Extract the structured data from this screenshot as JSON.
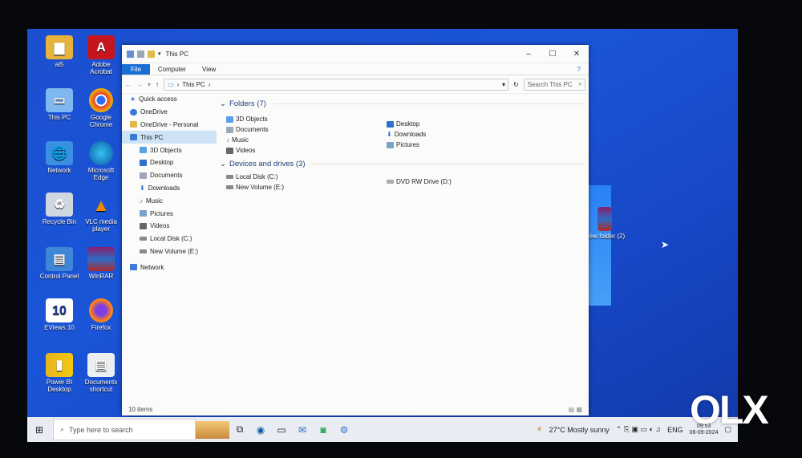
{
  "desktop": {
    "icons": [
      {
        "label": "ai5",
        "icon": "folder-icon"
      },
      {
        "label": "Adobe Acrobat",
        "icon": "acrobat-icon"
      },
      {
        "label": "This PC",
        "icon": "this-pc-icon"
      },
      {
        "label": "Google Chrome",
        "icon": "chrome-icon"
      },
      {
        "label": "Network",
        "icon": "network-icon"
      },
      {
        "label": "Microsoft Edge",
        "icon": "edge-icon"
      },
      {
        "label": "Recycle Bin",
        "icon": "recycle-bin-icon"
      },
      {
        "label": "VLC media player",
        "icon": "vlc-icon"
      },
      {
        "label": "Control Panel",
        "icon": "control-panel-icon"
      },
      {
        "label": "WinRAR",
        "icon": "winrar-icon"
      },
      {
        "label": "EViews 10",
        "icon": "eviews-icon"
      },
      {
        "label": "Firefox",
        "icon": "firefox-icon"
      },
      {
        "label": "Power BI Desktop",
        "icon": "powerbi-icon"
      },
      {
        "label": "Documents shortcut",
        "icon": "documents-shortcut-icon"
      },
      {
        "label": "New folder (2)",
        "icon": "winrar-archive-icon"
      }
    ]
  },
  "window": {
    "title": "This PC",
    "ribbon_tabs": [
      "File",
      "Computer",
      "View"
    ],
    "address_path": "This PC",
    "search_placeholder": "Search This PC",
    "nav": [
      {
        "label": "Quick access",
        "icon": "star-icon",
        "level": 1
      },
      {
        "label": "OneDrive",
        "icon": "cloud-icon",
        "level": 1
      },
      {
        "label": "OneDrive - Personal",
        "icon": "cloud-folder-icon",
        "level": 1
      },
      {
        "label": "This PC",
        "icon": "computer-icon",
        "level": 1,
        "selected": true
      },
      {
        "label": "3D Objects",
        "icon": "cube-icon",
        "level": 2
      },
      {
        "label": "Desktop",
        "icon": "desktop-icon",
        "level": 2
      },
      {
        "label": "Documents",
        "icon": "documents-icon",
        "level": 2
      },
      {
        "label": "Downloads",
        "icon": "download-icon",
        "level": 2
      },
      {
        "label": "Music",
        "icon": "music-icon",
        "level": 2
      },
      {
        "label": "Pictures",
        "icon": "pictures-icon",
        "level": 2
      },
      {
        "label": "Videos",
        "icon": "videos-icon",
        "level": 2
      },
      {
        "label": "Local Disk (C:)",
        "icon": "drive-icon",
        "level": 2
      },
      {
        "label": "New Volume (E:)",
        "icon": "drive-icon",
        "level": 2
      },
      {
        "label": "Network",
        "icon": "network-icon",
        "level": 1
      }
    ],
    "folders_header": "Folders (7)",
    "folders_left": [
      "3D Objects",
      "Documents",
      "Music",
      "Videos"
    ],
    "folders_right": [
      "Desktop",
      "Downloads",
      "Pictures"
    ],
    "devices_header": "Devices and drives (3)",
    "devices": [
      "Local Disk (C:)",
      "New Volume (E:)",
      "DVD RW Drive (D:)"
    ],
    "status": "10 items"
  },
  "taskbar": {
    "search_placeholder": "Type here to search",
    "weather": "27°C  Mostly sunny",
    "lang": "ENG",
    "time": "09:53",
    "date": "06-09-2024"
  },
  "watermark": "OLX",
  "colors": {
    "accent": "#1a6fd6",
    "desktop": "#1a55d8",
    "selection": "#cfe3f7"
  }
}
